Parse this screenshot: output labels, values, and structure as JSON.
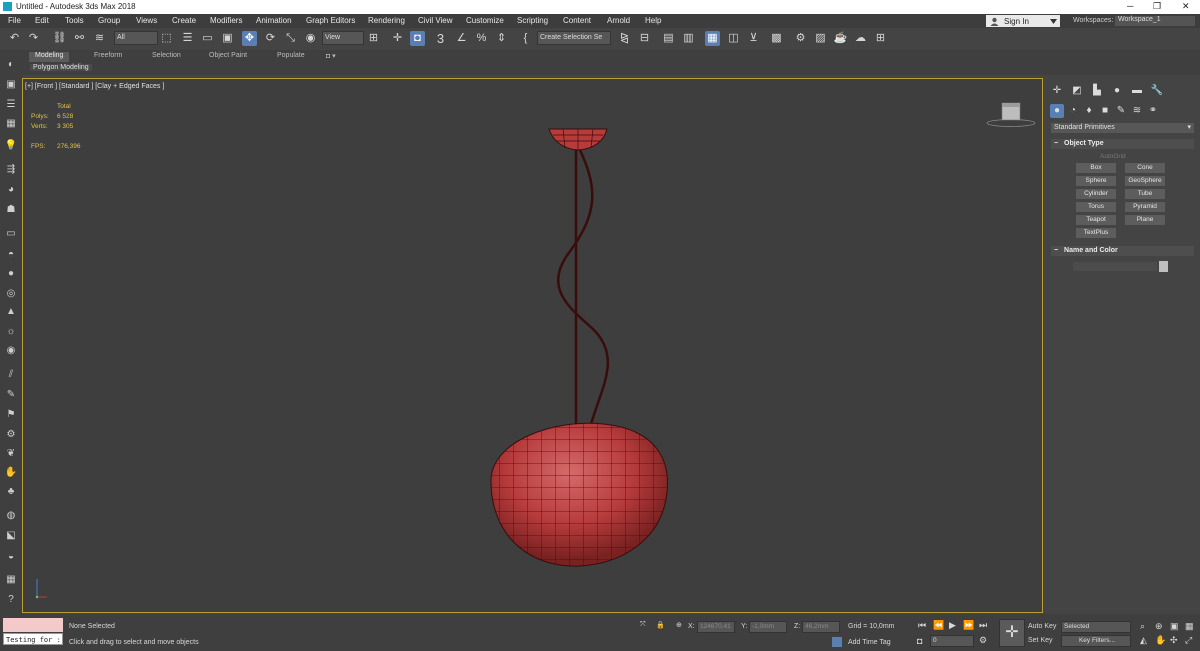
{
  "window": {
    "title": "Untitled - Autodesk 3ds Max 2018",
    "min": "─",
    "restore": "❐",
    "close": "✕"
  },
  "menu": [
    "File",
    "Edit",
    "Tools",
    "Group",
    "Views",
    "Create",
    "Modifiers",
    "Animation",
    "Graph Editors",
    "Rendering",
    "Civil View",
    "Customize",
    "Scripting",
    "Content",
    "Arnold",
    "Help"
  ],
  "account": {
    "signin": "Sign In",
    "workspaces_label": "Workspaces:",
    "workspace": "Workspace_1"
  },
  "toolbar": {
    "filter": "All",
    "coord": "View",
    "angle_snap": "3",
    "selection_set": "Create Selection Se"
  },
  "ribbon": {
    "tabs": [
      "Modeling",
      "Freeform",
      "Selection",
      "Object Paint",
      "Populate"
    ],
    "subpanel": "Polygon Modeling"
  },
  "viewport": {
    "label": "[+] [Front ] [Standard ] [Clay + Edged Faces ]",
    "stats": {
      "header": "Total",
      "polys_label": "Polys:",
      "polys": "6 528",
      "verts_label": "Verts:",
      "verts": "3 305",
      "fps_label": "FPS:",
      "fps": "276,396"
    },
    "object_color": "#b63b3b",
    "wire_color": "#3a0c0c",
    "frame_color": "#b9a031"
  },
  "cmdpanel": {
    "category": "Standard Primitives",
    "object_type": "Object Type",
    "autogrid": "AutoGrid",
    "buttons": [
      "Box",
      "Cone",
      "Sphere",
      "GeoSphere",
      "Cylinder",
      "Tube",
      "Torus",
      "Pyramid",
      "Teapot",
      "Plane",
      "TextPlus"
    ],
    "name_and_color": "Name and Color"
  },
  "statusbar": {
    "script_text": "Testing for :",
    "status": "None Selected",
    "prompt": "Click and drag to select and move objects",
    "x_label": "X:",
    "x": "124670,41",
    "y_label": "Y:",
    "y": "-1,0mm",
    "z_label": "Z:",
    "z": "46,2mm",
    "grid": "Grid = 10,0mm",
    "add_time_tag": "Add Time Tag",
    "auto_key": "Auto Key",
    "set_key": "Set Key",
    "selected": "Selected",
    "key_filters": "Key Filters...",
    "frame": "0"
  }
}
